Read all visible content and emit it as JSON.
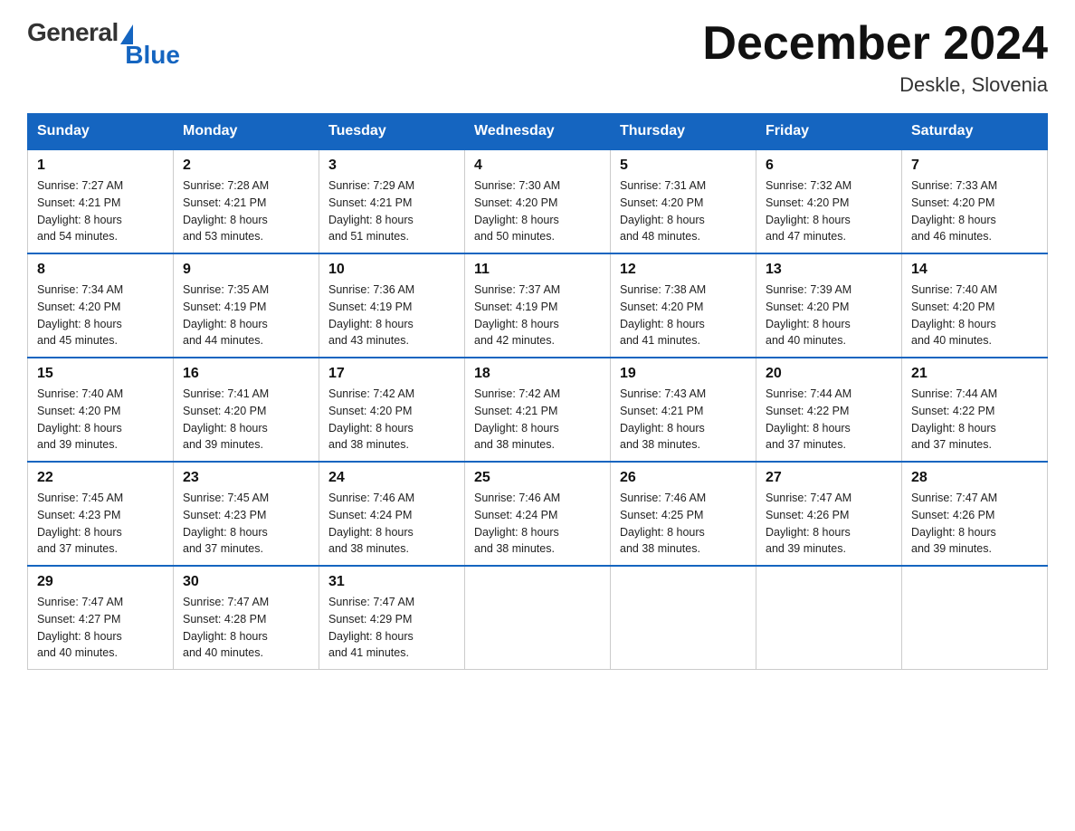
{
  "logo": {
    "general": "General",
    "blue": "Blue"
  },
  "header": {
    "month_title": "December 2024",
    "location": "Deskle, Slovenia"
  },
  "weekdays": [
    "Sunday",
    "Monday",
    "Tuesday",
    "Wednesday",
    "Thursday",
    "Friday",
    "Saturday"
  ],
  "weeks": [
    [
      {
        "day": "1",
        "sunrise": "7:27 AM",
        "sunset": "4:21 PM",
        "daylight": "8 hours and 54 minutes."
      },
      {
        "day": "2",
        "sunrise": "7:28 AM",
        "sunset": "4:21 PM",
        "daylight": "8 hours and 53 minutes."
      },
      {
        "day": "3",
        "sunrise": "7:29 AM",
        "sunset": "4:21 PM",
        "daylight": "8 hours and 51 minutes."
      },
      {
        "day": "4",
        "sunrise": "7:30 AM",
        "sunset": "4:20 PM",
        "daylight": "8 hours and 50 minutes."
      },
      {
        "day": "5",
        "sunrise": "7:31 AM",
        "sunset": "4:20 PM",
        "daylight": "8 hours and 48 minutes."
      },
      {
        "day": "6",
        "sunrise": "7:32 AM",
        "sunset": "4:20 PM",
        "daylight": "8 hours and 47 minutes."
      },
      {
        "day": "7",
        "sunrise": "7:33 AM",
        "sunset": "4:20 PM",
        "daylight": "8 hours and 46 minutes."
      }
    ],
    [
      {
        "day": "8",
        "sunrise": "7:34 AM",
        "sunset": "4:20 PM",
        "daylight": "8 hours and 45 minutes."
      },
      {
        "day": "9",
        "sunrise": "7:35 AM",
        "sunset": "4:19 PM",
        "daylight": "8 hours and 44 minutes."
      },
      {
        "day": "10",
        "sunrise": "7:36 AM",
        "sunset": "4:19 PM",
        "daylight": "8 hours and 43 minutes."
      },
      {
        "day": "11",
        "sunrise": "7:37 AM",
        "sunset": "4:19 PM",
        "daylight": "8 hours and 42 minutes."
      },
      {
        "day": "12",
        "sunrise": "7:38 AM",
        "sunset": "4:20 PM",
        "daylight": "8 hours and 41 minutes."
      },
      {
        "day": "13",
        "sunrise": "7:39 AM",
        "sunset": "4:20 PM",
        "daylight": "8 hours and 40 minutes."
      },
      {
        "day": "14",
        "sunrise": "7:40 AM",
        "sunset": "4:20 PM",
        "daylight": "8 hours and 40 minutes."
      }
    ],
    [
      {
        "day": "15",
        "sunrise": "7:40 AM",
        "sunset": "4:20 PM",
        "daylight": "8 hours and 39 minutes."
      },
      {
        "day": "16",
        "sunrise": "7:41 AM",
        "sunset": "4:20 PM",
        "daylight": "8 hours and 39 minutes."
      },
      {
        "day": "17",
        "sunrise": "7:42 AM",
        "sunset": "4:20 PM",
        "daylight": "8 hours and 38 minutes."
      },
      {
        "day": "18",
        "sunrise": "7:42 AM",
        "sunset": "4:21 PM",
        "daylight": "8 hours and 38 minutes."
      },
      {
        "day": "19",
        "sunrise": "7:43 AM",
        "sunset": "4:21 PM",
        "daylight": "8 hours and 38 minutes."
      },
      {
        "day": "20",
        "sunrise": "7:44 AM",
        "sunset": "4:22 PM",
        "daylight": "8 hours and 37 minutes."
      },
      {
        "day": "21",
        "sunrise": "7:44 AM",
        "sunset": "4:22 PM",
        "daylight": "8 hours and 37 minutes."
      }
    ],
    [
      {
        "day": "22",
        "sunrise": "7:45 AM",
        "sunset": "4:23 PM",
        "daylight": "8 hours and 37 minutes."
      },
      {
        "day": "23",
        "sunrise": "7:45 AM",
        "sunset": "4:23 PM",
        "daylight": "8 hours and 37 minutes."
      },
      {
        "day": "24",
        "sunrise": "7:46 AM",
        "sunset": "4:24 PM",
        "daylight": "8 hours and 38 minutes."
      },
      {
        "day": "25",
        "sunrise": "7:46 AM",
        "sunset": "4:24 PM",
        "daylight": "8 hours and 38 minutes."
      },
      {
        "day": "26",
        "sunrise": "7:46 AM",
        "sunset": "4:25 PM",
        "daylight": "8 hours and 38 minutes."
      },
      {
        "day": "27",
        "sunrise": "7:47 AM",
        "sunset": "4:26 PM",
        "daylight": "8 hours and 39 minutes."
      },
      {
        "day": "28",
        "sunrise": "7:47 AM",
        "sunset": "4:26 PM",
        "daylight": "8 hours and 39 minutes."
      }
    ],
    [
      {
        "day": "29",
        "sunrise": "7:47 AM",
        "sunset": "4:27 PM",
        "daylight": "8 hours and 40 minutes."
      },
      {
        "day": "30",
        "sunrise": "7:47 AM",
        "sunset": "4:28 PM",
        "daylight": "8 hours and 40 minutes."
      },
      {
        "day": "31",
        "sunrise": "7:47 AM",
        "sunset": "4:29 PM",
        "daylight": "8 hours and 41 minutes."
      },
      null,
      null,
      null,
      null
    ]
  ]
}
